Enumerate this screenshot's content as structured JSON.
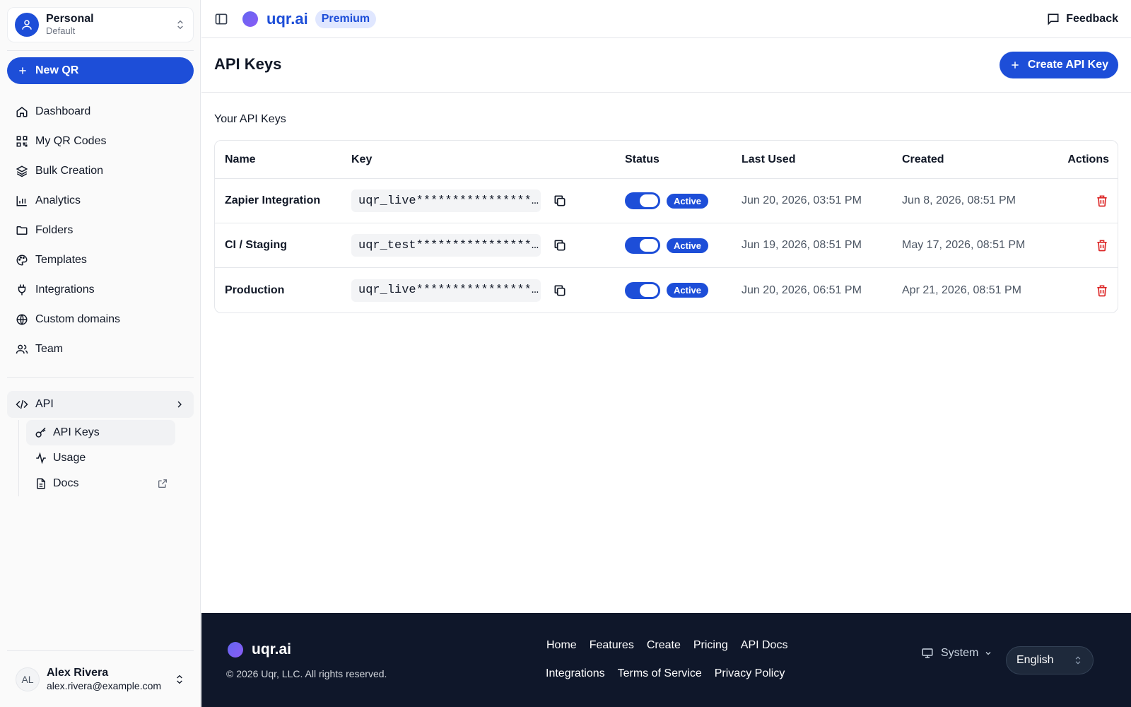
{
  "workspace": {
    "name": "Personal",
    "sub": "Default"
  },
  "sidebar": {
    "new_qr_label": "New QR",
    "items": [
      {
        "label": "Dashboard",
        "icon": "home-icon"
      },
      {
        "label": "My QR Codes",
        "icon": "qr-code-icon"
      },
      {
        "label": "Bulk Creation",
        "icon": "layers-icon"
      },
      {
        "label": "Analytics",
        "icon": "bar-chart-icon"
      },
      {
        "label": "Folders",
        "icon": "folder-icon"
      },
      {
        "label": "Templates",
        "icon": "palette-icon"
      },
      {
        "label": "Integrations",
        "icon": "plug-icon"
      },
      {
        "label": "Custom domains",
        "icon": "globe-icon"
      },
      {
        "label": "Team",
        "icon": "users-icon"
      }
    ],
    "api_group": {
      "label": "API",
      "icon": "code-icon"
    },
    "api_items": [
      {
        "label": "API Keys",
        "icon": "key-icon"
      },
      {
        "label": "Usage",
        "icon": "activity-icon"
      },
      {
        "label": "Docs",
        "icon": "file-text-icon"
      }
    ]
  },
  "user": {
    "initials": "AL",
    "name": "Alex Rivera",
    "email": "alex.rivera@example.com"
  },
  "topbar": {
    "brand": "uqr.ai",
    "plan_badge": "Premium",
    "feedback_label": "Feedback"
  },
  "header": {
    "title": "API Keys",
    "create_label": "Create API Key"
  },
  "section_title": "Your API Keys",
  "table": {
    "columns": [
      "Name",
      "Key",
      "Status",
      "Last Used",
      "Created",
      "Actions"
    ],
    "rows": [
      {
        "name": "Zapier Integration",
        "key": "uqr_live****************…",
        "status": "Active",
        "last_used": "Jun 20, 2026, 03:51 PM",
        "created": "Jun 8, 2026, 08:51 PM"
      },
      {
        "name": "CI / Staging",
        "key": "uqr_test****************…",
        "status": "Active",
        "last_used": "Jun 19, 2026, 08:51 PM",
        "created": "May 17, 2026, 08:51 PM"
      },
      {
        "name": "Production",
        "key": "uqr_live****************…",
        "status": "Active",
        "last_used": "Jun 20, 2026, 06:51 PM",
        "created": "Apr 21, 2026, 08:51 PM"
      }
    ]
  },
  "footer": {
    "brand": "uqr.ai",
    "copyright": "© 2026 Uqr, LLC. All rights reserved.",
    "links_row1": [
      "Home",
      "Features",
      "Create",
      "Pricing",
      "API Docs"
    ],
    "links_row2": [
      "Integrations",
      "Terms of Service",
      "Privacy Policy"
    ],
    "theme_label": "System",
    "language": "English"
  },
  "colors": {
    "accent": "#1d4ed8",
    "danger": "#dc2626",
    "footer_bg": "#0f172a"
  }
}
